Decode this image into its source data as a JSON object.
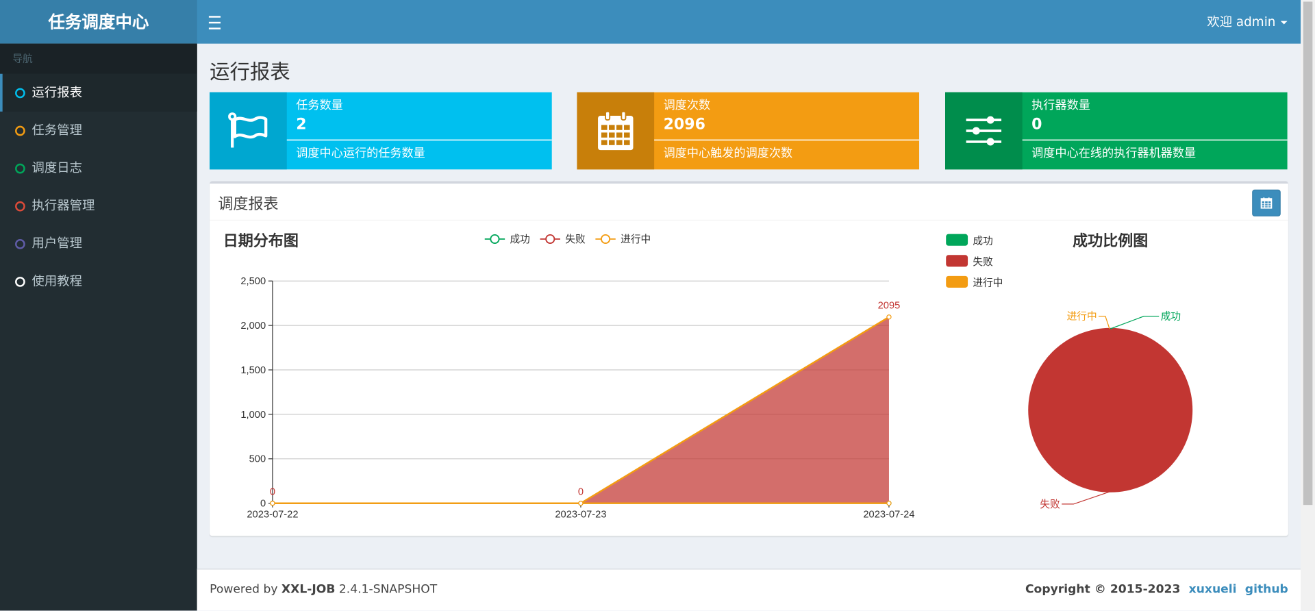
{
  "app": {
    "logo": "任务调度中心",
    "user_label": "欢迎 admin"
  },
  "sidebar": {
    "header": "导航",
    "items": [
      {
        "label": "运行报表",
        "color": "#00c0ef",
        "active": true
      },
      {
        "label": "任务管理",
        "color": "#f39c12"
      },
      {
        "label": "调度日志",
        "color": "#00a65a"
      },
      {
        "label": "执行器管理",
        "color": "#dd4b39"
      },
      {
        "label": "用户管理",
        "color": "#605ca8"
      },
      {
        "label": "使用教程",
        "color": "#ffffff"
      }
    ]
  },
  "page": {
    "title": "运行报表"
  },
  "infoboxes": [
    {
      "label": "任务数量",
      "value": "2",
      "desc": "调度中心运行的任务数量",
      "color": "#00c0ef",
      "icon_bg": "#00a7d0",
      "icon": "flag-icon"
    },
    {
      "label": "调度次数",
      "value": "2096",
      "desc": "调度中心触发的调度次数",
      "color": "#f39c12",
      "icon_bg": "#c87f0a",
      "icon": "calendar-icon"
    },
    {
      "label": "执行器数量",
      "value": "0",
      "desc": "调度中心在线的执行器机器数量",
      "color": "#00a65a",
      "icon_bg": "#008d4c",
      "icon": "sliders-icon"
    }
  ],
  "report": {
    "title": "调度报表",
    "cal_icon": "calendar-icon"
  },
  "chart_data": [
    {
      "type": "area",
      "title": "日期分布图",
      "categories": [
        "2023-07-22",
        "2023-07-23",
        "2023-07-24"
      ],
      "series": [
        {
          "name": "成功",
          "values": [
            0,
            0,
            0
          ],
          "color": "#00a65a"
        },
        {
          "name": "失败",
          "values": [
            0,
            0,
            2095
          ],
          "color": "#c23632"
        },
        {
          "name": "进行中",
          "values": [
            0,
            0,
            0
          ],
          "color": "#f39c12"
        }
      ],
      "data_labels": [
        "0",
        "0",
        "2095"
      ],
      "ylim": [
        0,
        2500
      ],
      "yticks": [
        0,
        500,
        1000,
        1500,
        2000,
        2500
      ],
      "ytick_labels": [
        "0",
        "500",
        "1,000",
        "1,500",
        "2,000",
        "2,500"
      ],
      "legend": "top"
    },
    {
      "type": "pie",
      "title": "成功比例图",
      "slices": [
        {
          "name": "成功",
          "value": 0,
          "color": "#00a65a"
        },
        {
          "name": "失败",
          "value": 2095,
          "color": "#c23632"
        },
        {
          "name": "进行中",
          "value": 0,
          "color": "#f39c12"
        }
      ],
      "legend": "top-left"
    }
  ],
  "footer": {
    "powered_prefix": "Powered by ",
    "brand": "XXL-JOB",
    "version": " 2.4.1-SNAPSHOT",
    "copyright": "Copyright © 2015-2023",
    "link1": "xuxueli",
    "link2": "github"
  }
}
